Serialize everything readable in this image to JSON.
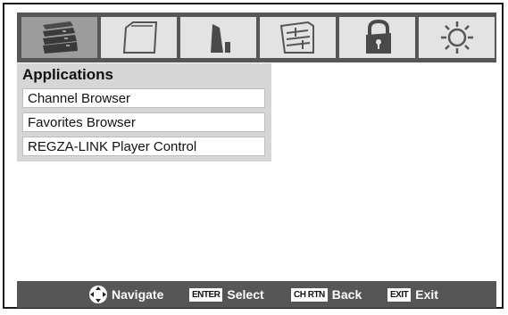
{
  "tabs": [
    {
      "name": "applications",
      "icon": "applications-icon",
      "active": true
    },
    {
      "name": "picture",
      "icon": "picture-icon",
      "active": false
    },
    {
      "name": "audio",
      "icon": "speaker-icon",
      "active": false
    },
    {
      "name": "preferences",
      "icon": "preferences-icon",
      "active": false
    },
    {
      "name": "locks",
      "icon": "lock-icon",
      "active": false
    },
    {
      "name": "setup",
      "icon": "gear-icon",
      "active": false
    }
  ],
  "panel": {
    "title": "Applications",
    "items": [
      "Channel Browser",
      "Favorites Browser",
      "REGZA-LINK Player Control"
    ]
  },
  "footer": {
    "navigate_label": "Navigate",
    "enter_key": "ENTER",
    "select_label": "Select",
    "chrtn_key": "CH RTN",
    "back_label": "Back",
    "exit_key": "EXIT",
    "exit_label": "Exit"
  },
  "colors": {
    "bar": "#565656",
    "tab": "#e3e3e3",
    "tab_active": "#9c9c9c",
    "panel": "#d6d6d6"
  }
}
